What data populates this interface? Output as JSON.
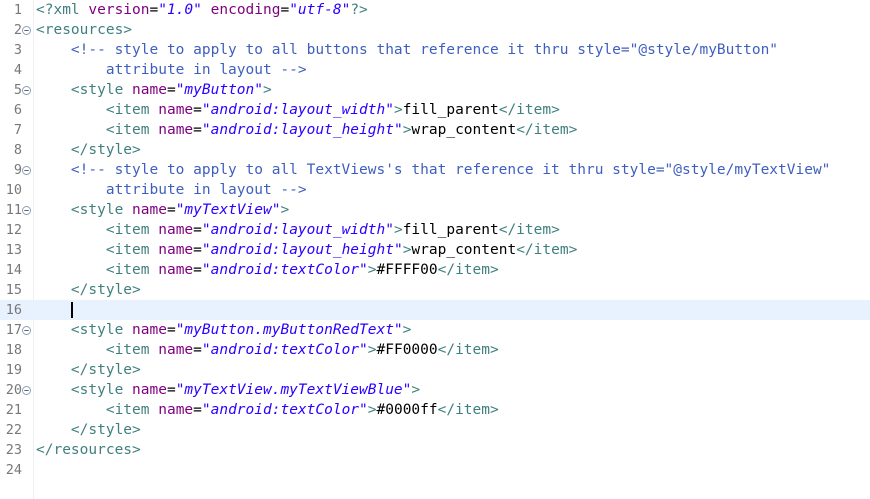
{
  "editor": {
    "colors": {
      "tag": "#3f7f7f",
      "attribute": "#7f007f",
      "value": "#2a00ff",
      "comment": "#3f5fbf",
      "text": "#000000",
      "current_line": "#e8f2fe"
    },
    "current_line": 16,
    "lines": [
      {
        "n": "1",
        "fold": false,
        "tokens": [
          [
            "pi",
            "<?xml "
          ],
          [
            "attr",
            "version"
          ],
          [
            "txt",
            "="
          ],
          [
            "val",
            "\"1.0\""
          ],
          [
            "txt",
            " "
          ],
          [
            "attr",
            "encoding"
          ],
          [
            "txt",
            "="
          ],
          [
            "val",
            "\"utf-8\""
          ],
          [
            "pi",
            "?>"
          ]
        ]
      },
      {
        "n": "2",
        "fold": true,
        "tokens": [
          [
            "tag",
            "<resources>"
          ]
        ]
      },
      {
        "n": "3",
        "fold": false,
        "tokens": [
          [
            "txt",
            "    "
          ],
          [
            "com",
            "<!-- style to apply to all buttons that reference it thru style=\"@style/myButton\""
          ]
        ]
      },
      {
        "n": "4",
        "fold": false,
        "tokens": [
          [
            "com",
            "        attribute in layout -->"
          ]
        ]
      },
      {
        "n": "5",
        "fold": true,
        "tokens": [
          [
            "txt",
            "    "
          ],
          [
            "tag",
            "<style "
          ],
          [
            "attr",
            "name"
          ],
          [
            "txt",
            "="
          ],
          [
            "val",
            "\"myButton\""
          ],
          [
            "tag",
            ">"
          ]
        ]
      },
      {
        "n": "6",
        "fold": false,
        "tokens": [
          [
            "txt",
            "        "
          ],
          [
            "tag",
            "<item "
          ],
          [
            "attr",
            "name"
          ],
          [
            "txt",
            "="
          ],
          [
            "val",
            "\"android:layout_width\""
          ],
          [
            "tag",
            ">"
          ],
          [
            "txt",
            "fill_parent"
          ],
          [
            "tag",
            "</item>"
          ]
        ]
      },
      {
        "n": "7",
        "fold": false,
        "tokens": [
          [
            "txt",
            "        "
          ],
          [
            "tag",
            "<item "
          ],
          [
            "attr",
            "name"
          ],
          [
            "txt",
            "="
          ],
          [
            "val",
            "\"android:layout_height\""
          ],
          [
            "tag",
            ">"
          ],
          [
            "txt",
            "wrap_content"
          ],
          [
            "tag",
            "</item>"
          ]
        ]
      },
      {
        "n": "8",
        "fold": false,
        "tokens": [
          [
            "txt",
            "    "
          ],
          [
            "tag",
            "</style>"
          ]
        ]
      },
      {
        "n": "9",
        "fold": true,
        "tokens": [
          [
            "txt",
            "    "
          ],
          [
            "com",
            "<!-- style to apply to all TextViews's that reference it thru style=\"@style/myTextView\""
          ]
        ]
      },
      {
        "n": "10",
        "fold": false,
        "tokens": [
          [
            "com",
            "        attribute in layout -->"
          ]
        ]
      },
      {
        "n": "11",
        "fold": true,
        "tokens": [
          [
            "txt",
            "    "
          ],
          [
            "tag",
            "<style "
          ],
          [
            "attr",
            "name"
          ],
          [
            "txt",
            "="
          ],
          [
            "val",
            "\"myTextView\""
          ],
          [
            "tag",
            ">"
          ]
        ]
      },
      {
        "n": "12",
        "fold": false,
        "tokens": [
          [
            "txt",
            "        "
          ],
          [
            "tag",
            "<item "
          ],
          [
            "attr",
            "name"
          ],
          [
            "txt",
            "="
          ],
          [
            "val",
            "\"android:layout_width\""
          ],
          [
            "tag",
            ">"
          ],
          [
            "txt",
            "fill_parent"
          ],
          [
            "tag",
            "</item>"
          ]
        ]
      },
      {
        "n": "13",
        "fold": false,
        "tokens": [
          [
            "txt",
            "        "
          ],
          [
            "tag",
            "<item "
          ],
          [
            "attr",
            "name"
          ],
          [
            "txt",
            "="
          ],
          [
            "val",
            "\"android:layout_height\""
          ],
          [
            "tag",
            ">"
          ],
          [
            "txt",
            "wrap_content"
          ],
          [
            "tag",
            "</item>"
          ]
        ]
      },
      {
        "n": "14",
        "fold": false,
        "tokens": [
          [
            "txt",
            "        "
          ],
          [
            "tag",
            "<item "
          ],
          [
            "attr",
            "name"
          ],
          [
            "txt",
            "="
          ],
          [
            "val",
            "\"android:textColor\""
          ],
          [
            "tag",
            ">"
          ],
          [
            "txt",
            "#FFFF00"
          ],
          [
            "tag",
            "</item>"
          ]
        ]
      },
      {
        "n": "15",
        "fold": false,
        "tokens": [
          [
            "txt",
            "    "
          ],
          [
            "tag",
            "</style>"
          ]
        ]
      },
      {
        "n": "16",
        "fold": false,
        "tokens": []
      },
      {
        "n": "17",
        "fold": true,
        "tokens": [
          [
            "txt",
            "    "
          ],
          [
            "tag",
            "<style "
          ],
          [
            "attr",
            "name"
          ],
          [
            "txt",
            "="
          ],
          [
            "val",
            "\"myButton.myButtonRedText\""
          ],
          [
            "tag",
            ">"
          ]
        ]
      },
      {
        "n": "18",
        "fold": false,
        "tokens": [
          [
            "txt",
            "        "
          ],
          [
            "tag",
            "<item "
          ],
          [
            "attr",
            "name"
          ],
          [
            "txt",
            "="
          ],
          [
            "val",
            "\"android:textColor\""
          ],
          [
            "tag",
            ">"
          ],
          [
            "txt",
            "#FF0000"
          ],
          [
            "tag",
            "</item>"
          ]
        ]
      },
      {
        "n": "19",
        "fold": false,
        "tokens": [
          [
            "txt",
            "    "
          ],
          [
            "tag",
            "</style>"
          ]
        ]
      },
      {
        "n": "20",
        "fold": true,
        "tokens": [
          [
            "txt",
            "    "
          ],
          [
            "tag",
            "<style "
          ],
          [
            "attr",
            "name"
          ],
          [
            "txt",
            "="
          ],
          [
            "val",
            "\"myTextView.myTextViewBlue\""
          ],
          [
            "tag",
            ">"
          ]
        ]
      },
      {
        "n": "21",
        "fold": false,
        "tokens": [
          [
            "txt",
            "        "
          ],
          [
            "tag",
            "<item "
          ],
          [
            "attr",
            "name"
          ],
          [
            "txt",
            "="
          ],
          [
            "val",
            "\"android:textColor\""
          ],
          [
            "tag",
            ">"
          ],
          [
            "txt",
            "#0000ff"
          ],
          [
            "tag",
            "</item>"
          ]
        ]
      },
      {
        "n": "22",
        "fold": false,
        "tokens": [
          [
            "txt",
            "    "
          ],
          [
            "tag",
            "</style>"
          ]
        ]
      },
      {
        "n": "23",
        "fold": false,
        "tokens": [
          [
            "tag",
            "</resources>"
          ]
        ]
      },
      {
        "n": "24",
        "fold": false,
        "tokens": []
      }
    ]
  }
}
